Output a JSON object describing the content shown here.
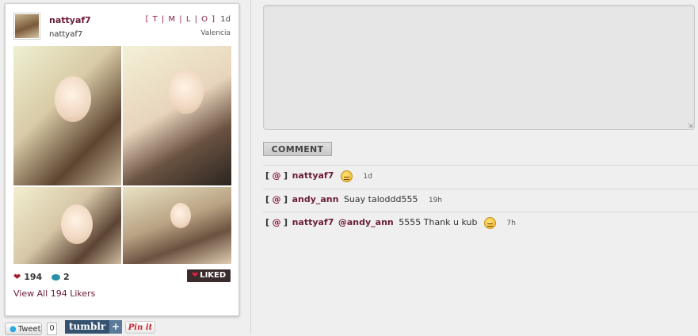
{
  "post": {
    "username": "nattyaf7",
    "display_name": "nattyaf7",
    "links": "[ T | M | L | O ]",
    "age": "1d",
    "location": "Valencia",
    "likes": "194",
    "comments": "2",
    "liked_label": "LIKED",
    "view_likers": "View All 194 Likers"
  },
  "share": {
    "tweet_label": "Tweet",
    "tweet_count": "0",
    "tumblr_label": "tumblr",
    "tumblr_plus": "+",
    "pin_label": "Pin it"
  },
  "compose": {
    "placeholder": "",
    "button_label": "COMMENT"
  },
  "comments": [
    {
      "bracket_open": "[",
      "at": "@",
      "bracket_close": "]",
      "user": "nattyaf7",
      "text": "",
      "age": "1d",
      "emoji": "grin-emoji"
    },
    {
      "bracket_open": "[",
      "at": "@",
      "bracket_close": "]",
      "user": "andy_ann",
      "text": "Suay taloddd555",
      "age": "19h"
    },
    {
      "bracket_open": "[",
      "at": "@",
      "bracket_close": "]",
      "user": "nattyaf7",
      "mention": "@andy_ann",
      "text": "5555 Thank u kub",
      "age": "7h",
      "emoji": "grin-emoji"
    }
  ],
  "colors": {
    "accent": "#6b1c37",
    "like_heart": "#a01c2c",
    "comment_bubble": "#2a8fa8",
    "background": "#efefef"
  }
}
